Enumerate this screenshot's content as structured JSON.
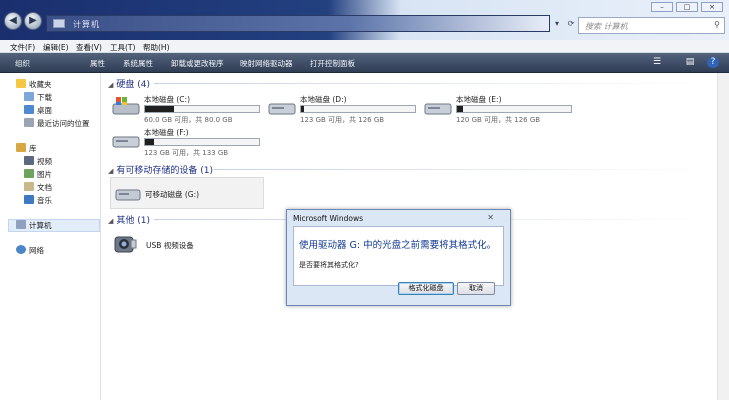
{
  "window": {
    "address_path": "计算机",
    "search_placeholder": "搜索 计算机"
  },
  "menu": [
    "文件(F)",
    "编辑(E)",
    "查看(V)",
    "工具(T)",
    "帮助(H)"
  ],
  "toolbar": [
    "组织",
    "属性",
    "系统属性",
    "卸载或更改程序",
    "映射网络驱动器",
    "打开控制面板"
  ],
  "sidebar": {
    "favorites": "收藏夹",
    "favorites_items": [
      "下载",
      "桌面",
      "最近访问的位置"
    ],
    "libraries": "库",
    "library_items": [
      "视频",
      "图片",
      "文档",
      "音乐"
    ],
    "computer": "计算机",
    "network": "网络"
  },
  "sections": {
    "hard_disks": "硬盘 (4)",
    "removable": "有可移动存储的设备 (1)",
    "other": "其他 (1)"
  },
  "drives": [
    {
      "name": "本地磁盘 (C:)",
      "info": "60.0 GB 可用，共 80.0 GB",
      "used_fraction": 0.25
    },
    {
      "name": "本地磁盘 (D:)",
      "info": "123 GB 可用，共 126 GB",
      "used_fraction": 0.03
    },
    {
      "name": "本地磁盘 (E:)",
      "info": "120 GB 可用，共 126 GB",
      "used_fraction": 0.05
    },
    {
      "name": "本地磁盘 (F:)",
      "info": "123 GB 可用，共 133 GB",
      "used_fraction": 0.08
    }
  ],
  "removable_drive": {
    "name": "可移动磁盘 (G:)"
  },
  "other_device": {
    "name": "USB 视频设备"
  },
  "dialog": {
    "title": "Microsoft Windows",
    "message": "使用驱动器 G: 中的光盘之前需要将其格式化。",
    "question": "是否要将其格式化?",
    "format_button": "格式化磁盘",
    "cancel_button": "取消"
  },
  "colors": {
    "link_blue": "#1e3287",
    "dialog_text": "#123a91",
    "toolbar_bg": "#2f3d55"
  }
}
